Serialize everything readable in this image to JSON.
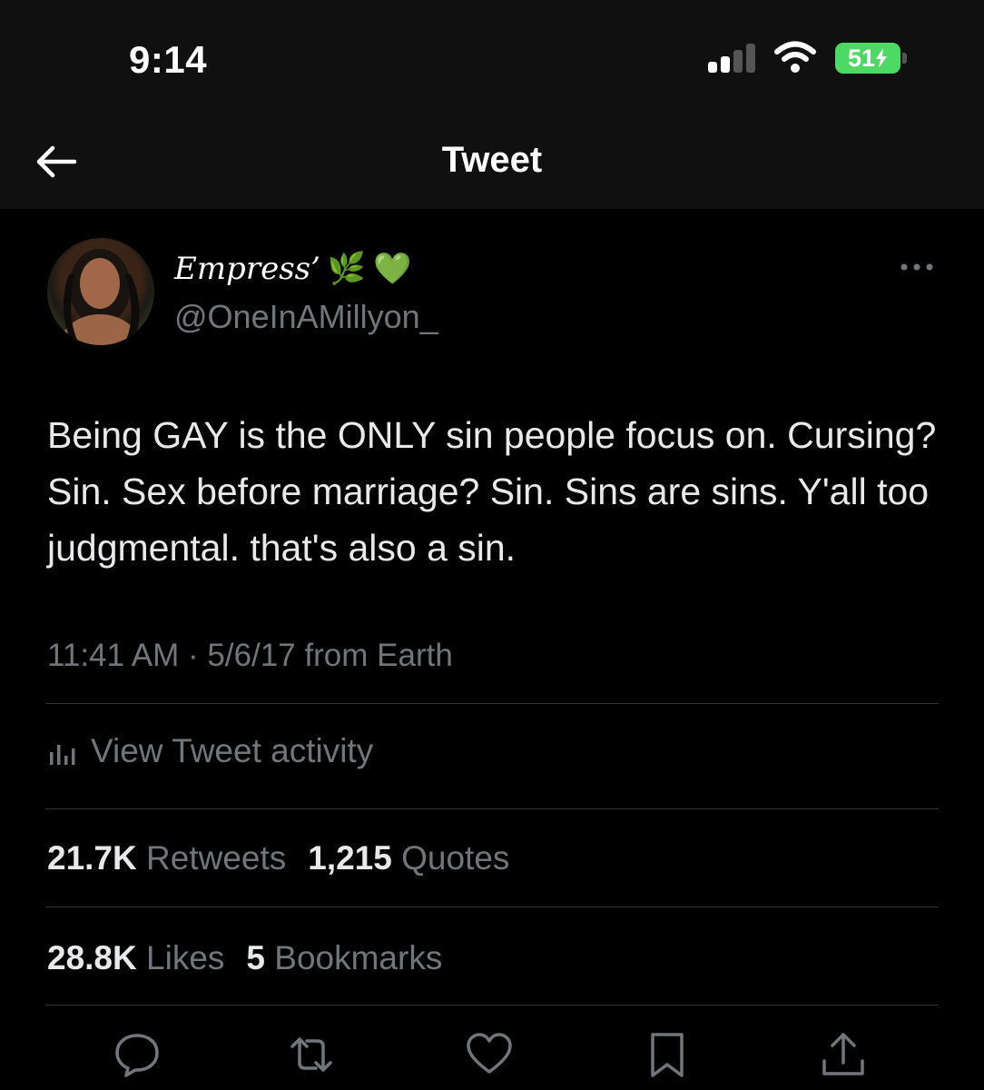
{
  "status_bar": {
    "time": "9:14",
    "battery": "51"
  },
  "nav": {
    "title": "Tweet",
    "back_icon": "arrow-left-icon"
  },
  "author": {
    "display_name": "Empress’",
    "emoji_herb": "🌿",
    "emoji_heart": "💚",
    "handle": "@OneInAMillyon_"
  },
  "tweet": {
    "text": "Being GAY is the ONLY sin people focus on. Cursing? Sin. Sex before marriage? Sin. Sins are sins. Y'all too judgmental. that's also a sin.",
    "meta": "11:41 AM · 5/6/17 from Earth"
  },
  "activity": {
    "label": "View Tweet activity",
    "icon": "bar-chart-icon"
  },
  "stats": {
    "retweets_count": "21.7K",
    "retweets_label": "Retweets",
    "quotes_count": "1,215",
    "quotes_label": "Quotes",
    "likes_count": "28.8K",
    "likes_label": "Likes",
    "bookmarks_count": "5",
    "bookmarks_label": "Bookmarks"
  },
  "actions": [
    "reply-icon",
    "retweet-icon",
    "like-icon",
    "bookmark-icon",
    "share-icon"
  ],
  "colors": {
    "background": "#000000",
    "muted": "#71767b",
    "text": "#e7e9ea",
    "battery": "#4cd964"
  }
}
